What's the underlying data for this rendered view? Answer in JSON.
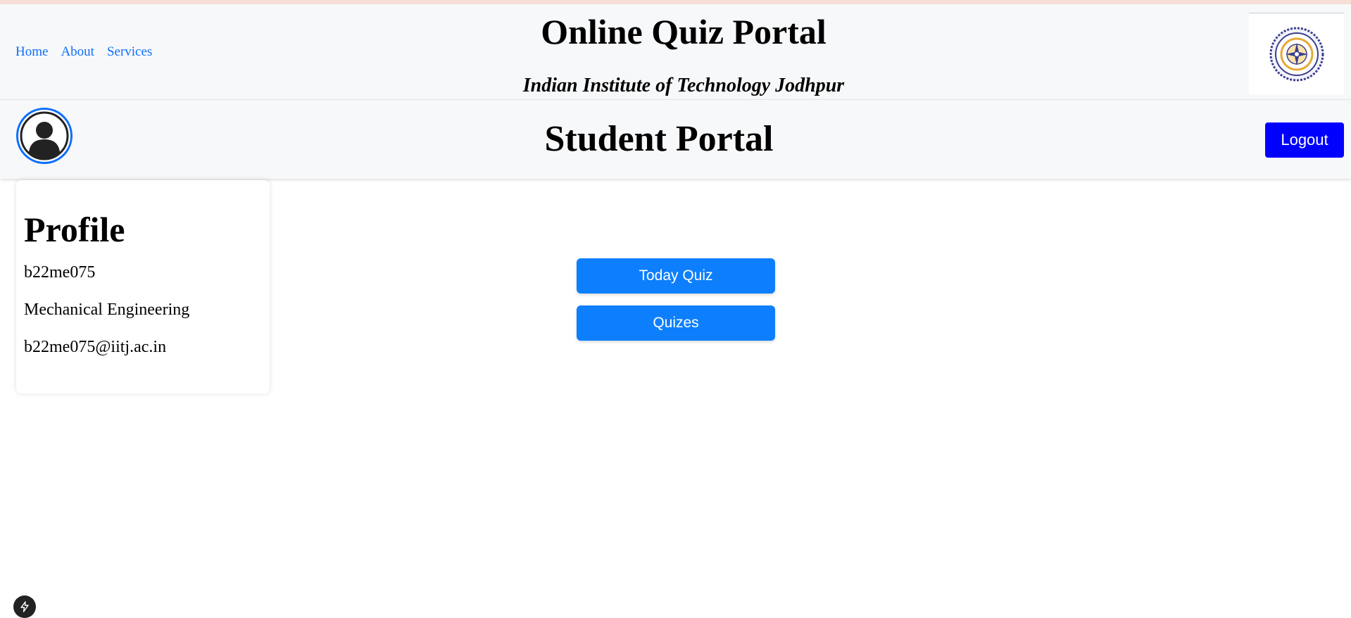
{
  "header": {
    "nav": [
      "Home",
      "About",
      "Services"
    ],
    "title": "Online Quiz Portal",
    "subtitle": "Indian Institute of Technology Jodhpur",
    "logo_icon": "iitj-emblem-logo"
  },
  "subheader": {
    "title": "Student Portal",
    "logout_label": "Logout",
    "avatar_icon": "user-avatar-icon"
  },
  "profile": {
    "heading": "Profile",
    "roll_no": "b22me075",
    "department": "Mechanical Engineering",
    "email": "b22me075@iitj.ac.in"
  },
  "actions": {
    "today_quiz_label": "Today Quiz",
    "quizes_label": "Quizes"
  },
  "colors": {
    "link": "#0d6efd",
    "logout_bg": "#0000ff",
    "action_bg": "#0d7ffd",
    "header_bg": "#f7f8fa"
  },
  "floating_button_icon": "bolt-icon"
}
